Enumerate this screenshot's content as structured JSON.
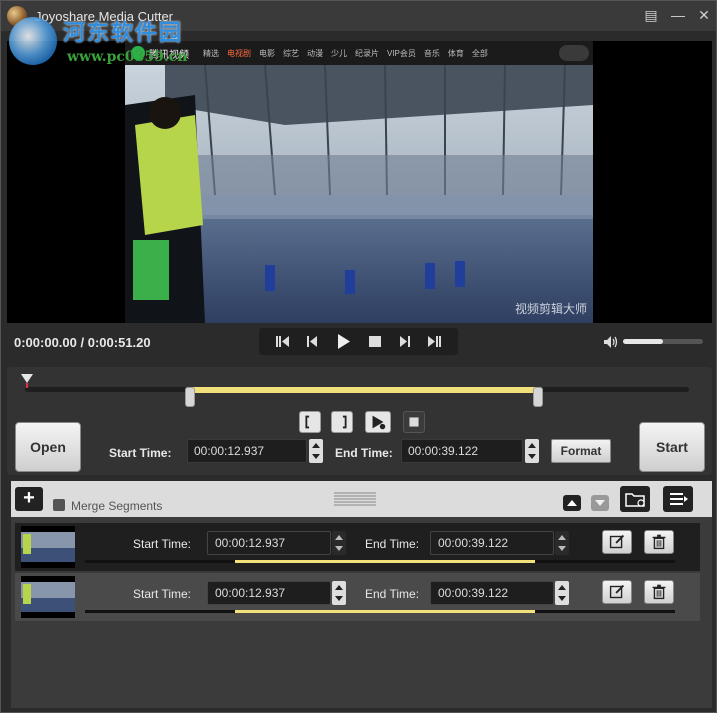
{
  "window": {
    "title": "Joyoshare Media Cutter",
    "watermark_text": "河东软件园",
    "watermark_url": "www.pc0359.cn"
  },
  "video": {
    "site_title": "腾讯视频",
    "nav_items": [
      "精选",
      "电视剧",
      "电影",
      "综艺",
      "动漫",
      "少儿",
      "纪录片",
      "VIP会员",
      "音乐",
      "体育",
      "全部"
    ],
    "frame_watermark": "视频剪辑大师",
    "current_time": "0:00:00.00",
    "separator": " / ",
    "total_time": "0:00:51.20",
    "volume_level": 0.5
  },
  "cutter": {
    "open_label": "Open",
    "start_label": "Start",
    "start_time_label": "Start Time:",
    "start_time_value": "00:00:12.937",
    "end_time_label": "End Time:",
    "end_time_value": "00:00:39.122",
    "format_label": "Format",
    "mark_in_icon": "bracket-left-icon",
    "mark_out_icon": "bracket-right-icon",
    "preview_icon": "play-segment-icon",
    "stop_icon": "stop-square-icon"
  },
  "segments_header": {
    "add_label": "+",
    "merge_label": "Merge Segments",
    "merge_checked": false
  },
  "segments": [
    {
      "start_label": "Start Time:",
      "start_value": "00:00:12.937",
      "end_label": "End Time:",
      "end_value": "00:00:39.122"
    },
    {
      "start_label": "Start Time:",
      "start_value": "00:00:12.937",
      "end_label": "End Time:",
      "end_value": "00:00:39.122"
    }
  ],
  "colors": {
    "accent_yellow": "#f2e07a",
    "background": "#2b2b2b",
    "panel": "#333333"
  }
}
